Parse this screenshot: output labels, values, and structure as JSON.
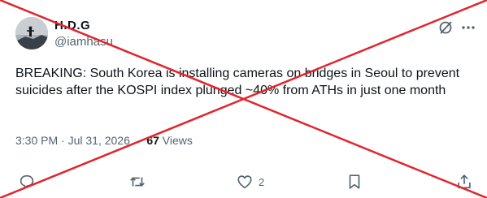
{
  "tweet": {
    "author_name": "H.D.G",
    "author_handle": "@iamhasu",
    "text": "BREAKING: South Korea is installing cameras on bridges in Seoul to prevent suicides after the KOSPI index plunged ~40% from ATHs in just one month",
    "timestamp": "3:30 PM · Jul 31, 2026",
    "separator": "·",
    "views_count": "67",
    "views_label": "Views"
  },
  "actions": {
    "reply_count": "",
    "retweet_count": "",
    "like_count": "2",
    "bookmark_count": ""
  },
  "icons": {
    "grok": "grok-slash-icon",
    "more": "more-horizontal-icon",
    "reply": "reply-bubble-icon",
    "retweet": "retweet-icon",
    "like": "heart-icon",
    "bookmark": "bookmark-icon",
    "share": "share-icon"
  },
  "overlay": {
    "color": "#e0262e"
  }
}
